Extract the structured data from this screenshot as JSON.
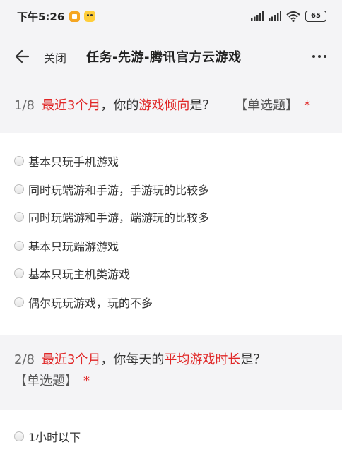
{
  "status_bar": {
    "time": "下午5:26",
    "battery": "65",
    "icons": [
      "notification-icon",
      "app-icon",
      "signal-icon",
      "signal-icon",
      "wifi-icon",
      "battery-icon"
    ]
  },
  "nav": {
    "close_label": "关闭",
    "title": "任务-先游-腾讯官方云游戏"
  },
  "questions": [
    {
      "number": "1/8",
      "parts": [
        "最近3个月",
        "，你的",
        "游戏倾向",
        "是？",
        "【单选题】",
        "*"
      ],
      "options": [
        "基本只玩手机游戏",
        "同时玩端游和手游，手游玩的比较多",
        "同时玩端游和手游，端游玩的比较多",
        "基本只玩端游游戏",
        "基本只玩主机类游戏",
        "偶尔玩玩游戏，玩的不多"
      ]
    },
    {
      "number": "2/8",
      "parts": [
        "最近3个月",
        "，你每天的",
        "平均游戏时长",
        "是？",
        "【单选题】",
        "*"
      ],
      "options": [
        "1小时以下"
      ]
    }
  ],
  "colors": {
    "accent_red": "#e02626",
    "background": "#f4f4f6",
    "card": "#ffffff"
  }
}
